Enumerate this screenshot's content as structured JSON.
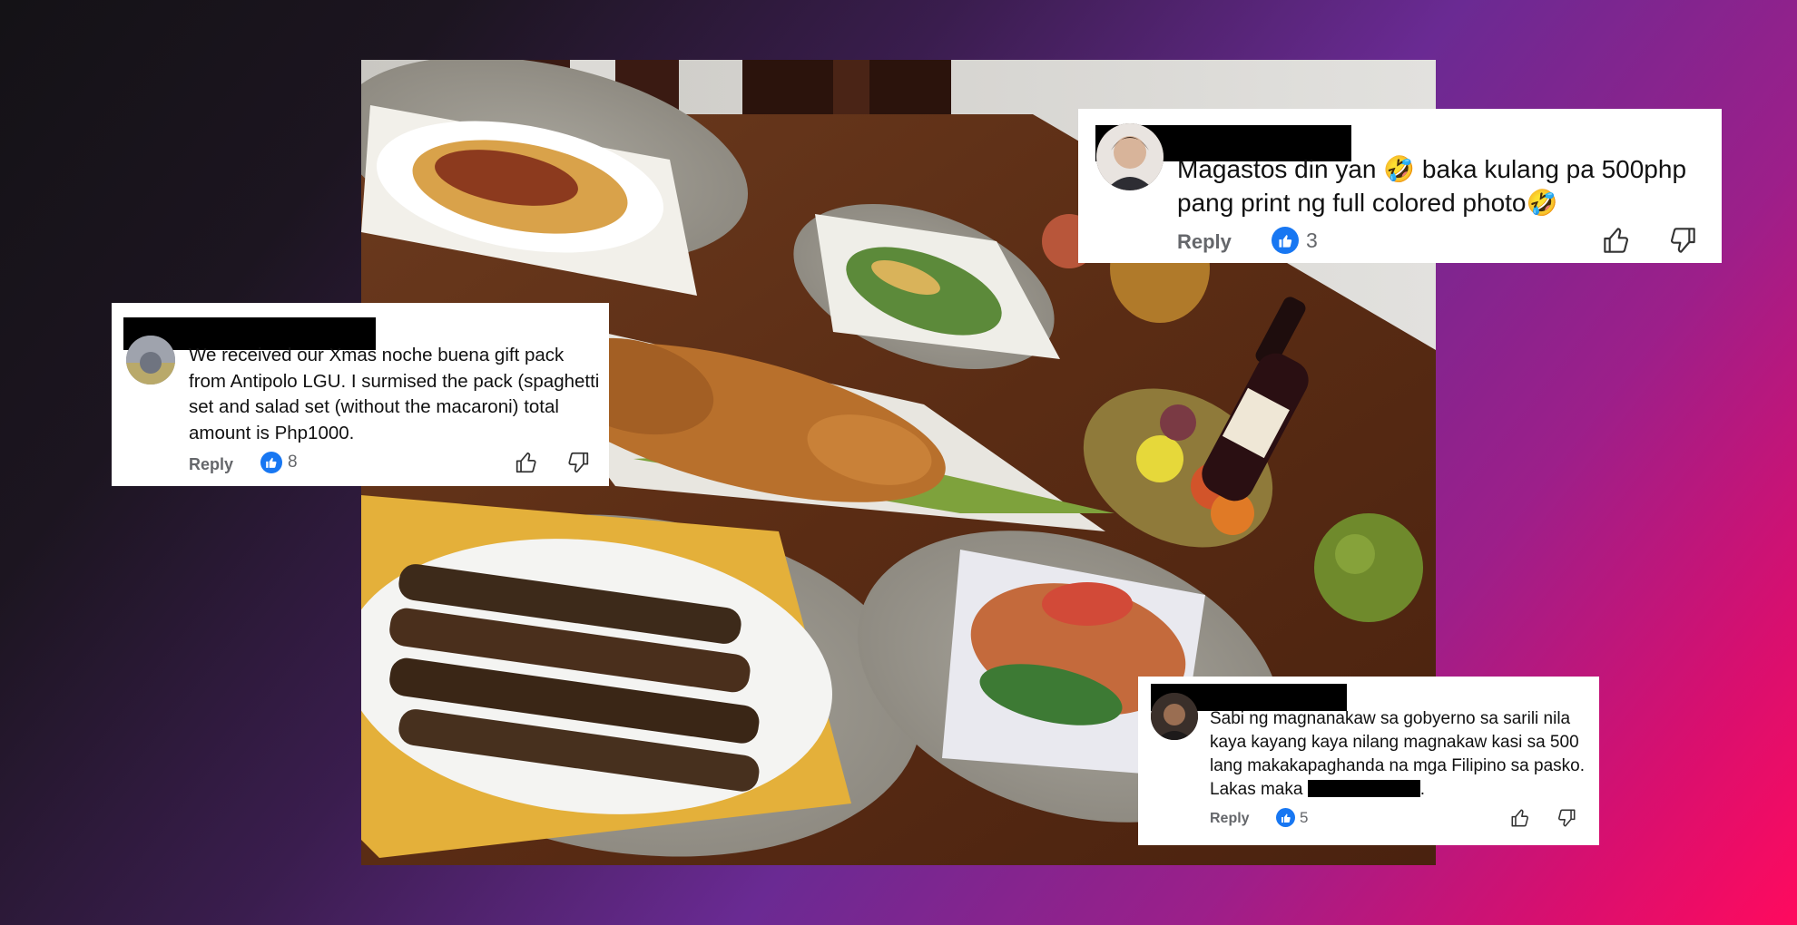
{
  "colors": {
    "like_blue": "#1877f2",
    "reply_gray": "#65676b",
    "card_bg": "#ffffff",
    "redaction": "#000000"
  },
  "photo": {
    "description_icon": "food-photo",
    "items": [
      "spaghetti-plate",
      "salad-plate",
      "lechon-pig",
      "bbq-skewers",
      "seafood-plate",
      "fruit-basket",
      "wine-bottle",
      "pomelo"
    ]
  },
  "comments": [
    {
      "text": "We received our Xmas noche buena gift pack from Antipolo LGU. I surmised the pack (spaghetti set and salad set (without the macaroni) total amount is Php1000.",
      "reply_label": "Reply",
      "like_count": "8",
      "like_icon": "thumbs-up-icon",
      "upvote_icon": "thumbs-up-outline-icon",
      "downvote_icon": "thumbs-down-outline-icon"
    },
    {
      "text": "Magastos din yan 🤣 baka kulang pa 500php pang print ng full colored photo🤣",
      "reply_label": "Reply",
      "like_count": "3",
      "like_icon": "thumbs-up-icon",
      "upvote_icon": "thumbs-up-outline-icon",
      "downvote_icon": "thumbs-down-outline-icon"
    },
    {
      "text_before_redaction": "Sabi ng magnanakaw sa gobyerno sa sarili nila kaya kayang kaya nilang magnakaw kasi sa 500 lang makakapaghanda na mga Filipino sa pasko. Lakas maka ",
      "text_after_redaction": ".",
      "reply_label": "Reply",
      "like_count": "5",
      "like_icon": "thumbs-up-icon",
      "upvote_icon": "thumbs-up-outline-icon",
      "downvote_icon": "thumbs-down-outline-icon"
    }
  ]
}
